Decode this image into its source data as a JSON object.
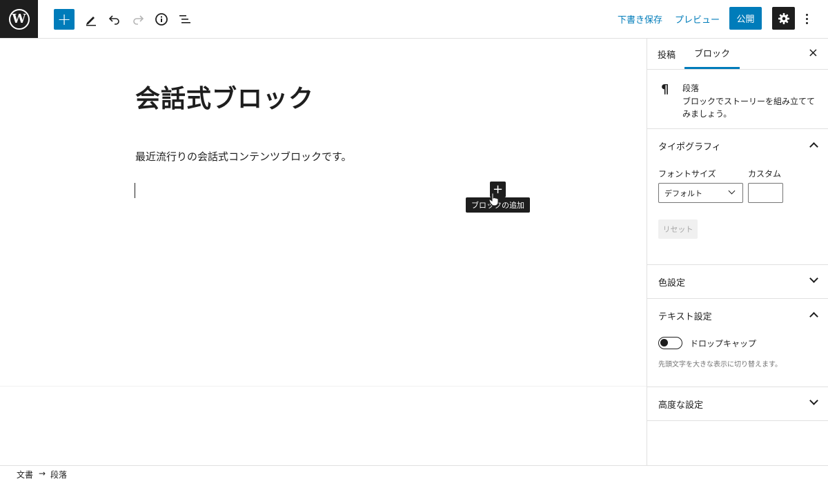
{
  "toolbar": {
    "logo": "W",
    "add_label": "+",
    "save_draft": "下書き保存",
    "preview": "プレビュー",
    "publish": "公開"
  },
  "editor": {
    "title": "会話式ブロック",
    "paragraph": "最近流行りの会話式コンテンツブロックです。",
    "inserter_label": "+",
    "tooltip": "ブロックの追加"
  },
  "sidebar": {
    "tabs": [
      "投稿",
      "ブロック"
    ],
    "close": "×",
    "block": {
      "icon": "¶",
      "name": "段落",
      "description": "ブロックでストーリーを組み立ててみましょう。"
    },
    "typography": {
      "title": "タイポグラフィ",
      "font_size_label": "フォントサイズ",
      "custom_label": "カスタム",
      "font_size_value": "デフォルト",
      "custom_value": "",
      "reset": "リセット"
    },
    "color": {
      "title": "色設定"
    },
    "text_settings": {
      "title": "テキスト設定",
      "drop_cap_label": "ドロップキャップ",
      "drop_cap_on": false,
      "help": "先頭文字を大きな表示に切り替えます。"
    },
    "advanced": {
      "title": "高度な設定"
    }
  },
  "breadcrumb": [
    "文書",
    "→",
    "段落"
  ],
  "colors": {
    "accent": "#007cba",
    "dark": "#1e1e1e"
  }
}
